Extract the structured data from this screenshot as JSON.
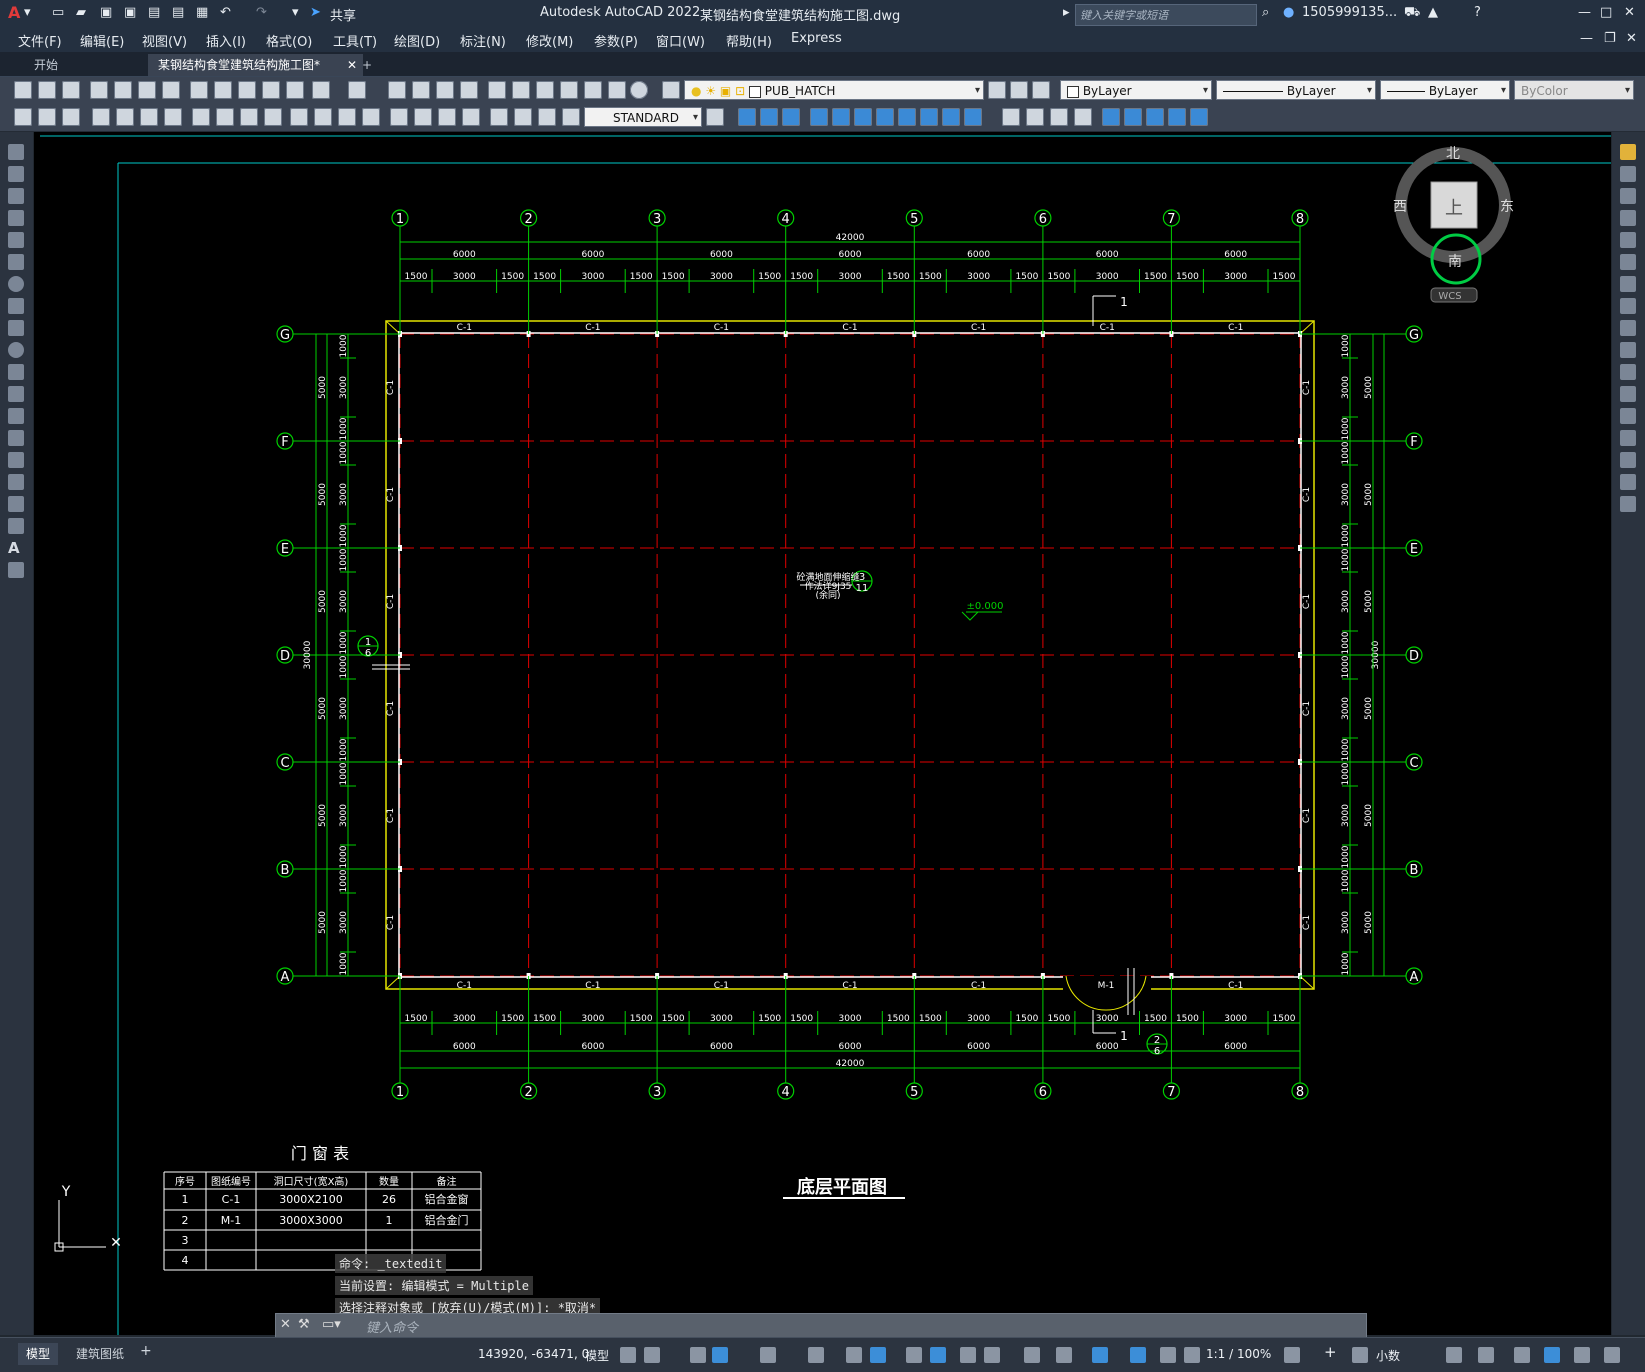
{
  "app": {
    "title": "Autodesk AutoCAD 2022",
    "filename": "某钢结构食堂建筑结构施工图.dwg",
    "share": "共享",
    "search_placeholder": "键入关键字或短语",
    "user": "1505999135...",
    "logo": "A"
  },
  "menu": [
    "文件(F)",
    "编辑(E)",
    "视图(V)",
    "插入(I)",
    "格式(O)",
    "工具(T)",
    "绘图(D)",
    "标注(N)",
    "修改(M)",
    "参数(P)",
    "窗口(W)",
    "帮助(H)",
    "Express"
  ],
  "tabs": {
    "start": "开始",
    "active": "某钢结构食堂建筑结构施工图*",
    "add": "+"
  },
  "layer": {
    "name": "PUB_HATCH"
  },
  "properties": {
    "color": "ByLayer",
    "linetype": "ByLayer",
    "lineweight": "ByLayer",
    "plotstyle": "ByColor"
  },
  "textstyle": "STANDARD",
  "viewcube": {
    "north": "北",
    "south": "南",
    "east": "东",
    "west": "西",
    "face": "上",
    "wcs": "WCS"
  },
  "drawing": {
    "axes_num": [
      "1",
      "2",
      "3",
      "4",
      "5",
      "6",
      "7",
      "8"
    ],
    "axes_letter": [
      "G",
      "F",
      "E",
      "D",
      "C",
      "B",
      "A"
    ],
    "overall_width": "42000",
    "bay": "6000",
    "sub_dims": [
      "1500",
      "3000",
      "1500"
    ],
    "overall_depth": "30000",
    "row_dim": "5000",
    "row_sub": [
      "1000",
      "3000",
      "1000"
    ],
    "window_tag": "C-1",
    "door_tag": "M-1",
    "section_mark": "1",
    "elev_mark": "±0.000",
    "note_lines": [
      "砼满地面伸缩缝",
      "作法详9J35",
      "(余同)"
    ],
    "detail_d": {
      "num": "1",
      "ref": "6"
    },
    "detail_a": {
      "num": "2",
      "ref": "6"
    },
    "detail_center": {
      "num": "3",
      "ref": "11"
    },
    "plan_title": "底层平面图",
    "table_title": "门 窗 表",
    "table_headers": [
      "序号",
      "图纸编号",
      "洞口尺寸(宽X高)",
      "数量",
      "备注"
    ],
    "table_rows": [
      [
        "1",
        "C-1",
        "3000X2100",
        "26",
        "铝合金窗"
      ],
      [
        "2",
        "M-1",
        "3000X3000",
        "1",
        "铝合金门"
      ],
      [
        "3",
        "",
        "",
        "",
        ""
      ],
      [
        "4",
        "",
        "",
        "",
        ""
      ]
    ],
    "ucs_y": "Y"
  },
  "command": {
    "history": [
      "命令: _textedit",
      "当前设置: 编辑模式 = Multiple",
      "选择注释对象或 [放弃(U)/模式(M)]: *取消*"
    ],
    "placeholder": "键入命令"
  },
  "status": {
    "layouts": [
      "模型",
      "建筑图纸"
    ],
    "coords": "143920, -63471, 0",
    "space": "模型",
    "scale": "1:1 / 100%",
    "units": "小数"
  }
}
